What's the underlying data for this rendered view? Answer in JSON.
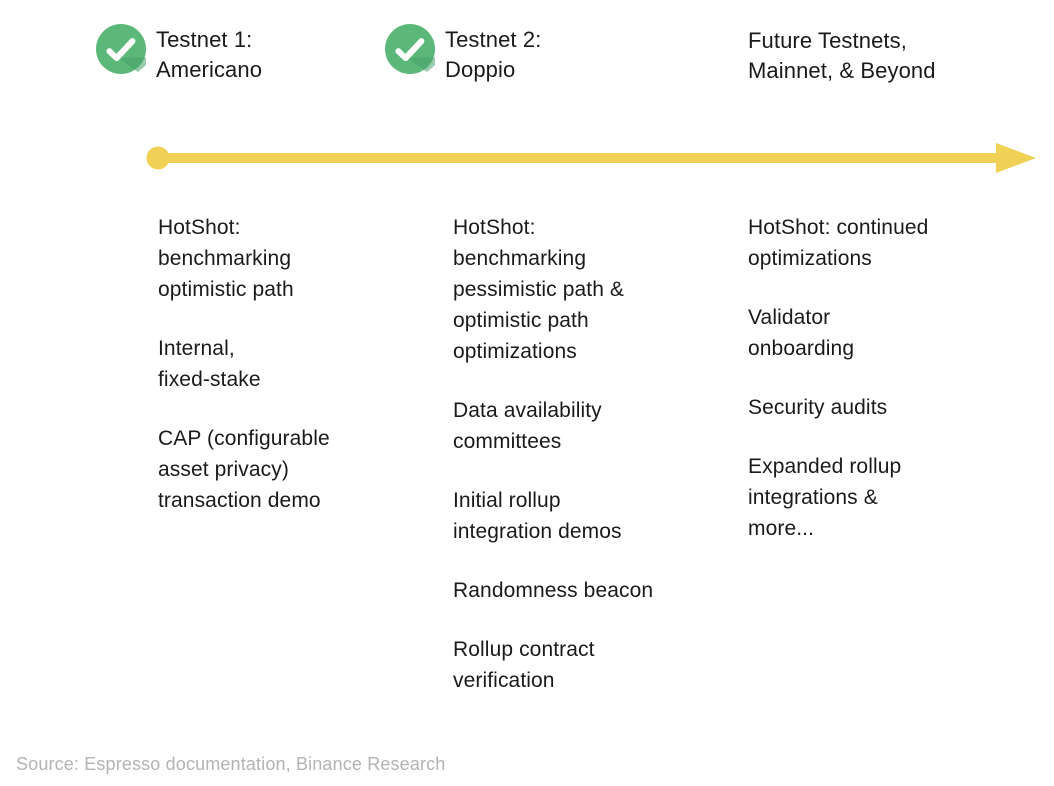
{
  "milestones": [
    {
      "id": "testnet-1",
      "label": "Testnet 1:\nAmericano",
      "status_icon": "check-circle-icon",
      "completed": true
    },
    {
      "id": "testnet-2",
      "label": "Testnet 2:\nDoppio",
      "status_icon": "check-circle-icon",
      "completed": true
    },
    {
      "id": "future",
      "label": "Future Testnets,\nMainnet, & Beyond",
      "status_icon": null,
      "completed": false
    }
  ],
  "timeline": {
    "start_marker": "dot",
    "end_marker": "arrowhead",
    "color": "#f0d055"
  },
  "columns": [
    {
      "id": "testnet-1-items",
      "items": [
        "HotShot:\nbenchmarking\noptimistic path",
        "Internal,\nfixed-stake",
        "CAP (configurable\nasset privacy)\ntransaction demo"
      ]
    },
    {
      "id": "testnet-2-items",
      "items": [
        "HotShot:\nbenchmarking\npessimistic path &\noptimistic path\noptimizations",
        "Data availability\ncommittees",
        "Initial rollup\nintegration demos",
        "Randomness beacon",
        "Rollup contract\nverification"
      ]
    },
    {
      "id": "future-items",
      "items": [
        "HotShot: continued\noptimizations",
        "Validator\nonboarding",
        "Security audits",
        "Expanded rollup\nintegrations &\nmore..."
      ]
    }
  ],
  "footer": {
    "source": "Source: Espresso documentation, Binance Research"
  },
  "colors": {
    "check_green": "#5cb878",
    "check_green_shadow": "#46a06a",
    "timeline_yellow": "#f0d055",
    "text": "#1a1a1a",
    "source_text": "#b3b3b3",
    "background": "#ffffff"
  }
}
